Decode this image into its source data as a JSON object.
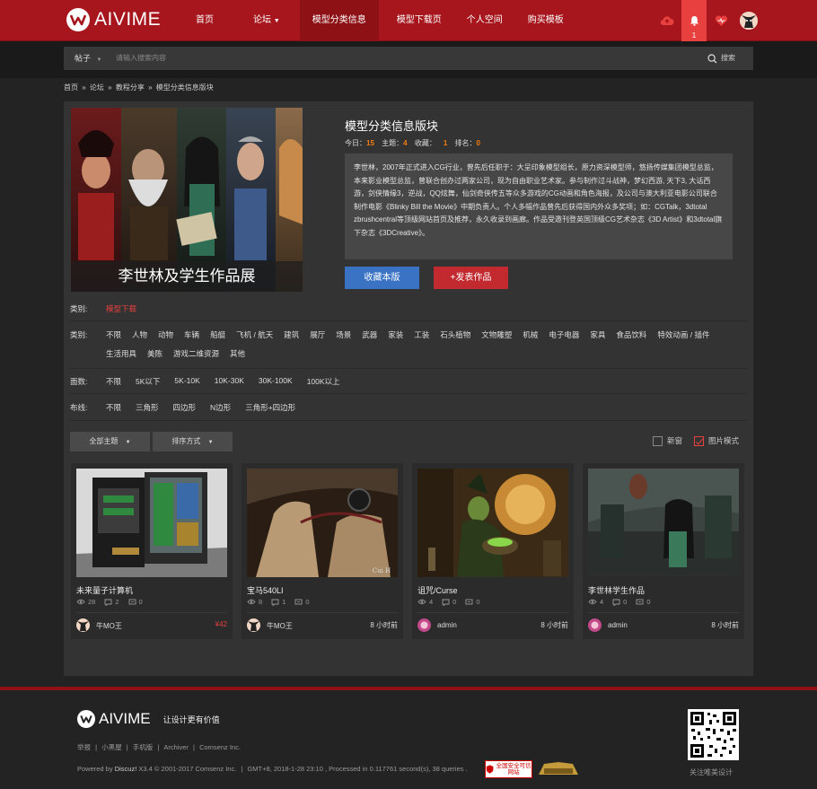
{
  "brand": {
    "name": "AIVIME"
  },
  "nav": {
    "items": [
      {
        "label": "首页",
        "active": false
      },
      {
        "label": "论坛",
        "active": false,
        "dropdown": true
      },
      {
        "label": "模型分类信息",
        "active": true
      },
      {
        "label": "模型下载页",
        "active": false
      },
      {
        "label": "个人空间",
        "active": false
      },
      {
        "label": "购买模板",
        "active": false
      }
    ],
    "notification_count": "1",
    "icons": [
      "cloud-upload-icon",
      "bell-icon",
      "heart-icon",
      "avatar"
    ]
  },
  "search": {
    "category": "帖子",
    "placeholder": "请输入搜索内容",
    "button_label": "搜索"
  },
  "breadcrumb": [
    "首页",
    "»",
    "论坛",
    "»",
    "教程分享",
    "»",
    "模型分类信息版块"
  ],
  "forum": {
    "banner_caption": "李世林及学生作品展",
    "title": "模型分类信息版块",
    "stats": {
      "today_label": "今日：",
      "today": "15",
      "threads_label": "主题：",
      "threads": "4",
      "favorites_label": "收藏：",
      "favorites": "1",
      "rank_label": "排名：",
      "rank": "0"
    },
    "description": "李世林，2007年正式进入CG行业，曾先后任职于：大呈印象模型组长，原力资深模型师，悠扬传媒集团模型总监，本来影业模型总监，曾联合创办过两家公司，现为自由职业艺术家。参与制作过斗战神，梦幻西游, 天下3, 大话西游，剑侠情缘3，逆战，QQ炫舞，仙剑奇侠传五等众多游戏的CG动画和角色海报，及公司与澳大利亚电影公司联合制作电影《Blinky Bill the Movie》中期负责人。个人多幅作品曾先后获得国内外众多奖项；如：CGTalk，3dtotal zbrushcentral等顶级网站首页及推荐，永久收录到画廊。作品受邀刊登英国顶级CG艺术杂志《3D Artist》和3dtotal旗下杂志《3DCreative》。",
    "favorite_button": "收藏本版",
    "post_button": "+发表作品"
  },
  "filters": {
    "row1": {
      "label": "类别:",
      "options": [
        "模型下载"
      ]
    },
    "row2": {
      "label": "类别:",
      "options": [
        "不限",
        "人物",
        "动物",
        "车辆",
        "船艇",
        "飞机 / 航天",
        "建筑",
        "展厅",
        "场景",
        "武器",
        "家装",
        "工装",
        "石头植物",
        "文物雕塑",
        "机械",
        "电子电器",
        "家具",
        "食品饮料",
        "特效动画 / 插件",
        "生活用具",
        "美陈",
        "游戏二维资源",
        "其他"
      ]
    },
    "row3": {
      "label": "面数:",
      "options": [
        "不限",
        "5K以下",
        "5K-10K",
        "10K-30K",
        "30K-100K",
        "100K以上"
      ]
    },
    "row4": {
      "label": "布线:",
      "options": [
        "不限",
        "三角形",
        "四边形",
        "N边形",
        "三角形+四边形"
      ]
    }
  },
  "toolbar": {
    "all_threads": "全部主题",
    "sort": "排序方式",
    "new_window": "新窗",
    "image_mode": "图片模式"
  },
  "cards": [
    {
      "title": "未来量子计算机",
      "views": "28",
      "replies": "2",
      "comments": "0",
      "user": "牛MO王",
      "right": "¥42",
      "is_price": true
    },
    {
      "title": "宝马540LI",
      "views": "8",
      "replies": "1",
      "comments": "0",
      "user": "牛MO王",
      "right": "8 小时前",
      "is_price": false
    },
    {
      "title": "诅咒/Curse",
      "views": "4",
      "replies": "0",
      "comments": "0",
      "user": "admin",
      "right": "8 小时前",
      "is_price": false
    },
    {
      "title": "李世林学生作品",
      "views": "4",
      "replies": "0",
      "comments": "0",
      "user": "admin",
      "right": "8 小时前",
      "is_price": false
    }
  ],
  "card_watermark": "Cui H",
  "footer": {
    "slogan": "让设计更有价值",
    "links": [
      "举报",
      "|",
      "小黑屋",
      "|",
      "手机版",
      "|",
      "Archiver",
      "|",
      "Comsenz Inc."
    ],
    "powered_prefix": "Powered by ",
    "powered_name": "Discuz!",
    "powered_version": " X3.4 ",
    "copyright": "© 2001-2017 Comsenz Inc.",
    "sep": "|",
    "gmt": "GMT+8, 2018-1-28 23:10 , Processed in 0.117761 second(s), 38 queries .",
    "badge1": "全国安全可信网站",
    "qr_caption": "关注唯美设计"
  },
  "colors": {
    "brand_red": "#a6161c",
    "accent_orange": "#f67d13",
    "blue_button": "#3b73c4",
    "red_button": "#c22a2f"
  }
}
